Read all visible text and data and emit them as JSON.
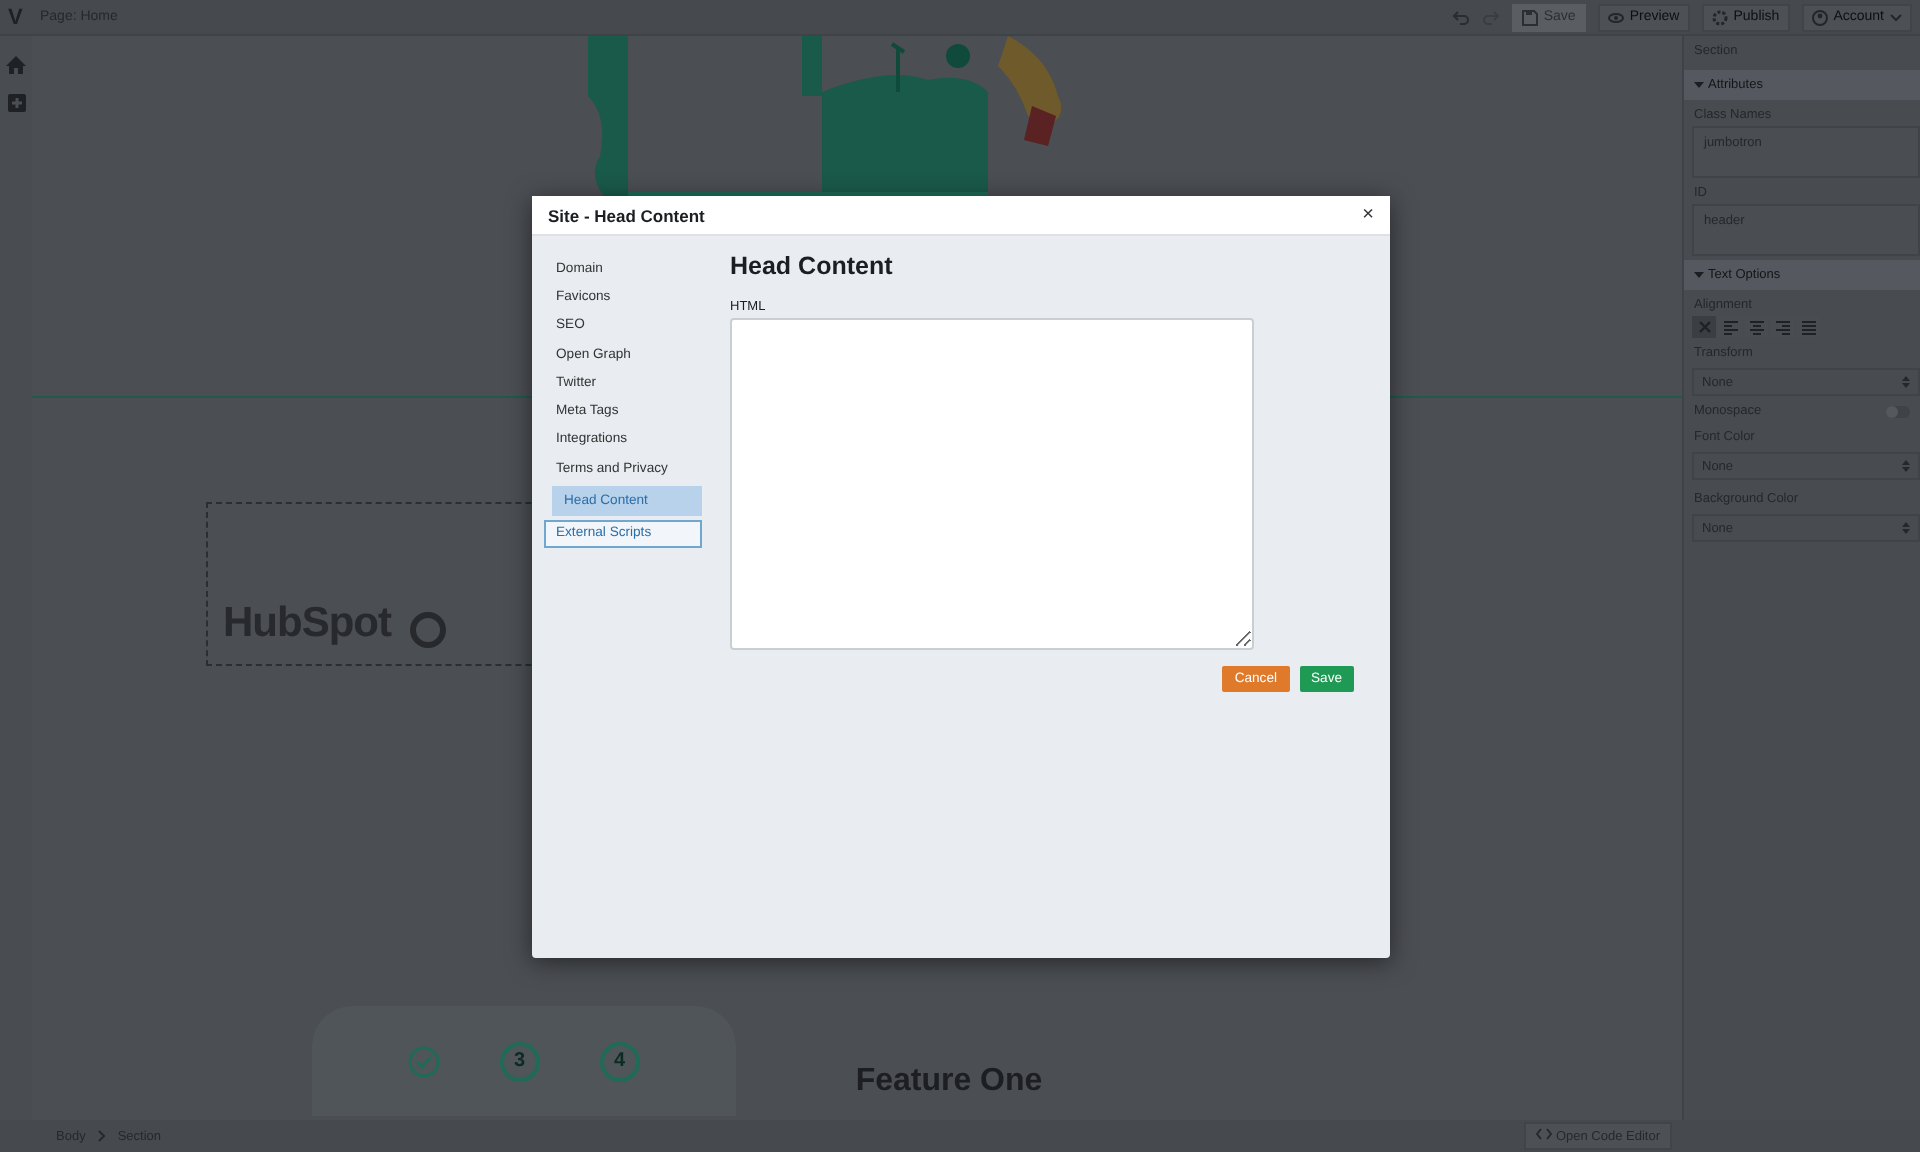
{
  "topbar": {
    "logo": "V",
    "page_title": "Page: Home",
    "save": {
      "label": "Save",
      "disabled": true
    },
    "buttons": [
      "Preview",
      "Publish",
      "Account"
    ]
  },
  "canvas": {
    "logo_text": "HubSpot",
    "steps": [
      "3",
      "4"
    ],
    "feature_title": "Feature One"
  },
  "inspector": {
    "title": "Section",
    "groups": [
      {
        "title": "Attributes",
        "expanded": true,
        "fields": [
          {
            "kind": "text",
            "label": "Class Names",
            "value": "jumbotron"
          },
          {
            "kind": "text",
            "label": "ID",
            "value": "header"
          }
        ]
      },
      {
        "title": "Text Options",
        "expanded": true,
        "fields": [
          {
            "kind": "align",
            "label": "Alignment",
            "options": [
              {
                "selected": true
              },
              {
                "selected": false
              },
              {
                "selected": false
              },
              {
                "selected": false
              },
              {
                "selected": false
              }
            ]
          },
          {
            "kind": "select",
            "label": "Transform",
            "value": "None"
          },
          {
            "kind": "toggle",
            "label": "Monospace",
            "on": false
          },
          {
            "kind": "select",
            "label": "Font Color",
            "value": "None"
          },
          {
            "kind": "select",
            "label": "Background Color",
            "value": "None"
          }
        ]
      }
    ]
  },
  "breadcrumb": [
    "Body",
    "Section"
  ],
  "code_editor_button": "Open Code Editor",
  "dialog": {
    "title": "Site - Head Content",
    "close": "×",
    "nav": [
      {
        "label": "Domain",
        "selected": false,
        "hovered": false
      },
      {
        "label": "Favicons",
        "selected": false,
        "hovered": false
      },
      {
        "label": "SEO",
        "selected": false,
        "hovered": false
      },
      {
        "label": "Open Graph",
        "selected": false,
        "hovered": false
      },
      {
        "label": "Twitter",
        "selected": false,
        "hovered": false
      },
      {
        "label": "Meta Tags",
        "selected": false,
        "hovered": false
      },
      {
        "label": "Integrations",
        "selected": false,
        "hovered": false
      },
      {
        "label": "Terms and Privacy",
        "selected": false,
        "hovered": false
      },
      {
        "label": "Head Content",
        "selected": true,
        "hovered": false
      },
      {
        "label": "External Scripts",
        "selected": false,
        "hovered": true
      }
    ],
    "heading": "Head Content",
    "field_label": "HTML",
    "buttons": [
      {
        "kind": "cancel",
        "label": "Cancel"
      },
      {
        "kind": "save",
        "label": "Save"
      }
    ]
  }
}
